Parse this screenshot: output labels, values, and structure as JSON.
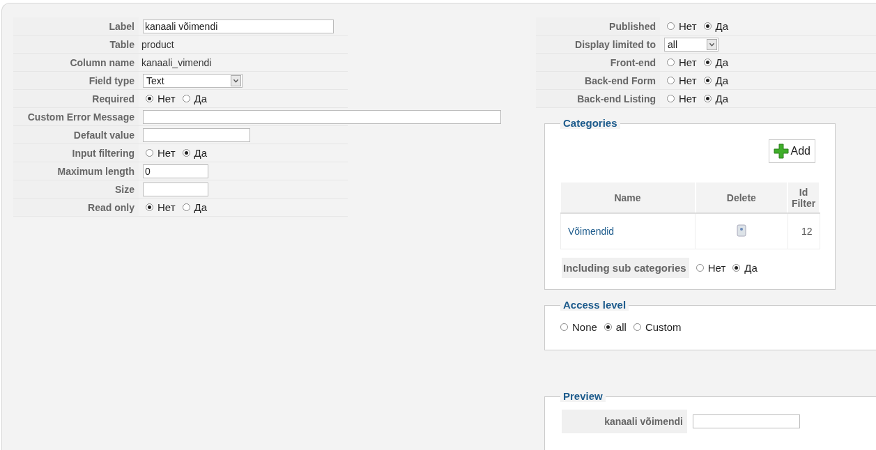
{
  "fields": [
    {
      "label": "Label",
      "kind": "input",
      "value": "kanaali võimendi"
    },
    {
      "label": "Table",
      "kind": "text",
      "value": "product"
    },
    {
      "label": "Column name",
      "kind": "text",
      "value": "kanaali_vimendi"
    },
    {
      "label": "Field type",
      "kind": "select",
      "value": "Text"
    },
    {
      "label": "Required",
      "kind": "radio",
      "options": [
        {
          "label": "Нет",
          "selected": true
        },
        {
          "label": "Да",
          "selected": false
        }
      ]
    },
    {
      "label": "Custom Error Message",
      "kind": "input"
    },
    {
      "label": "Default value",
      "kind": "input"
    },
    {
      "label": "Input filtering",
      "kind": "radio",
      "options": [
        {
          "label": "Нет",
          "selected": false
        },
        {
          "label": "Да",
          "selected": true
        }
      ]
    },
    {
      "label": "Maximum length",
      "kind": "input",
      "value": "0"
    },
    {
      "label": "Size",
      "kind": "input"
    },
    {
      "label": "Read only",
      "kind": "radio",
      "options": [
        {
          "label": "Нет",
          "selected": true
        },
        {
          "label": "Да",
          "selected": false
        }
      ]
    }
  ],
  "settings": [
    {
      "label": "Published",
      "kind": "radio",
      "options": [
        {
          "label": "Нет",
          "selected": false
        },
        {
          "label": "Да",
          "selected": true
        }
      ]
    },
    {
      "label": "Display limited to",
      "kind": "select",
      "value": "all"
    },
    {
      "label": "Front-end",
      "kind": "radio",
      "options": [
        {
          "label": "Нет",
          "selected": false
        },
        {
          "label": "Да",
          "selected": true
        }
      ]
    },
    {
      "label": "Back-end Form",
      "kind": "radio",
      "options": [
        {
          "label": "Нет",
          "selected": false
        },
        {
          "label": "Да",
          "selected": true
        }
      ]
    },
    {
      "label": "Back-end Listing",
      "kind": "radio",
      "options": [
        {
          "label": "Нет",
          "selected": false
        },
        {
          "label": "Да",
          "selected": true
        }
      ]
    }
  ],
  "categories": {
    "title": "Categories",
    "add_button": "Add",
    "columns": [
      "Name",
      "Delete",
      "Id Filter"
    ],
    "rows": [
      {
        "name": "Võimendid",
        "id_filter": "12"
      }
    ],
    "sub_categories": {
      "label": "Including sub categories",
      "options": [
        {
          "label": "Нет",
          "selected": false
        },
        {
          "label": "Да",
          "selected": true
        }
      ]
    }
  },
  "access_level": {
    "title": "Access level",
    "options": [
      {
        "label": "None",
        "selected": false
      },
      {
        "label": "all",
        "selected": true
      },
      {
        "label": "Custom",
        "selected": false
      }
    ]
  },
  "preview": {
    "title": "Preview",
    "label": "kanaali võimendi"
  }
}
